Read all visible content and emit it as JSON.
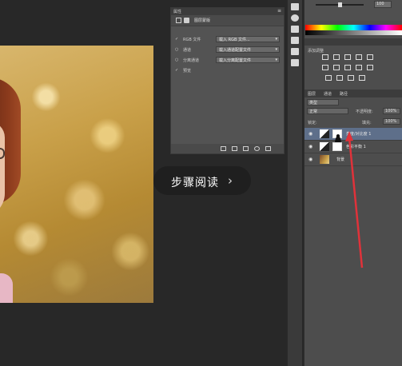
{
  "properties_panel": {
    "tab_label": "属性",
    "menu_label": "≡",
    "title": "图层蒙版",
    "rows": [
      {
        "checked": "✓",
        "label": "RGB 文件",
        "value": "载入 RGB 文件..."
      },
      {
        "checked": "",
        "label": "通道",
        "value": "载入通道配置文件"
      },
      {
        "checked": "",
        "label": "分离通道",
        "value": "载入分离配置文件"
      },
      {
        "checked": "✓",
        "label": "预览",
        "value": ""
      }
    ]
  },
  "color_panel": {
    "slider_value": "100",
    "adjustments_title": "添加调整"
  },
  "layers_panel": {
    "tabs": [
      "图层",
      "通道",
      "路径"
    ],
    "mode": "正常",
    "opacity_label": "不透明度:",
    "opacity_value": "100%",
    "lock_label": "锁定:",
    "fill_label": "填充:",
    "fill_value": "100%",
    "kind_label": "类型",
    "layers": [
      {
        "name": "亮度/对比度 1",
        "selected": true
      },
      {
        "name": "色彩平衡 1",
        "selected": false
      },
      {
        "name": "背景",
        "selected": false
      }
    ]
  },
  "overlay": {
    "step_label": "步骤阅读",
    "chevron": "›"
  },
  "colors": {
    "accent_arrow": "#e0323a",
    "selected_layer": "#5e6f8a"
  }
}
